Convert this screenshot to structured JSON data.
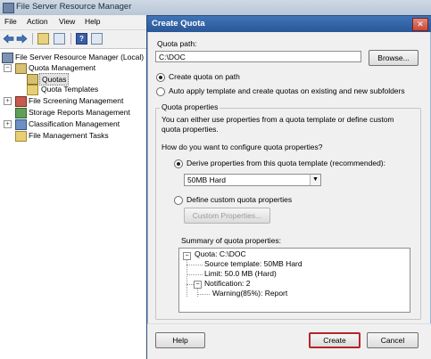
{
  "mmc": {
    "title": "File Server Resource Manager",
    "menu": [
      "File",
      "Action",
      "View",
      "Help"
    ],
    "toolbar_help_glyph": "?",
    "tree": {
      "root": "File Server Resource Manager (Local)",
      "quota_management": "Quota Management",
      "quotas": "Quotas",
      "quota_templates": "Quota Templates",
      "file_screening": "File Screening Management",
      "storage_reports": "Storage Reports Management",
      "classification": "Classification Management",
      "file_management_tasks": "File Management Tasks",
      "expand_glyph": "+",
      "collapse_glyph": "−"
    }
  },
  "dialog": {
    "title": "Create Quota",
    "close_glyph": "✕",
    "quota_path_label": "Quota path:",
    "quota_path_value": "C:\\DOC",
    "browse_label": "Browse...",
    "radio_create_on_path": "Create quota on path",
    "radio_auto_apply": "Auto apply template and create quotas on existing and new subfolders",
    "quota_properties_legend": "Quota properties",
    "properties_description": "You can either use properties from a quota template or define custom quota properties.",
    "how_configure": "How do you want to configure quota properties?",
    "radio_derive": "Derive properties from this quota template (recommended):",
    "template_selected": "50MB Hard",
    "combo_arrow_glyph": "▼",
    "radio_define_custom": "Define custom quota properties",
    "custom_properties_button": "Custom Properties...",
    "summary_label": "Summary of quota properties:",
    "summary": {
      "quota": "Quota: C:\\DOC",
      "source_template": "Source template: 50MB Hard",
      "limit": "Limit: 50.0 MB (Hard)",
      "notification": "Notification: 2",
      "warning": "Warning(85%): Report"
    },
    "help_button": "Help",
    "create_button": "Create",
    "cancel_button": "Cancel"
  }
}
